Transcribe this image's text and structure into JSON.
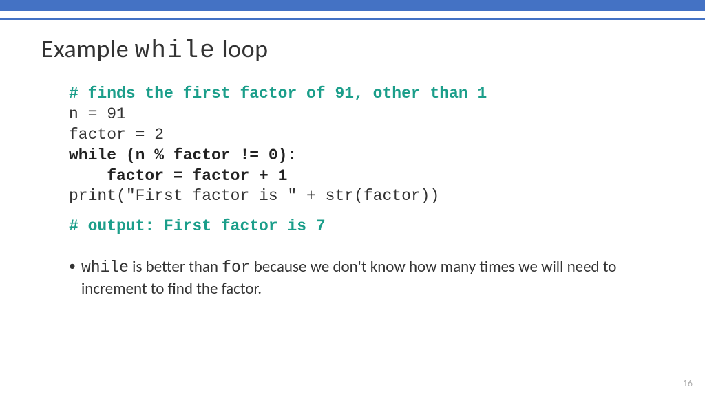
{
  "title": {
    "pre": "Example ",
    "mono": "while",
    "post": " loop"
  },
  "code": {
    "line1": "# finds the first factor of 91, other than 1",
    "line2": "n = 91",
    "line3": "factor = 2",
    "line4": "while (n % factor != 0):",
    "line5": "    factor = factor + 1",
    "line6": "print(\"First factor is \" + str(factor))",
    "output": "# output:  First factor is 7"
  },
  "bullet": {
    "mono1": "while",
    "seg1": " is better than ",
    "mono2": "for",
    "seg2": " because we don't know how many times we will need to increment to find the factor."
  },
  "page_number": "16"
}
